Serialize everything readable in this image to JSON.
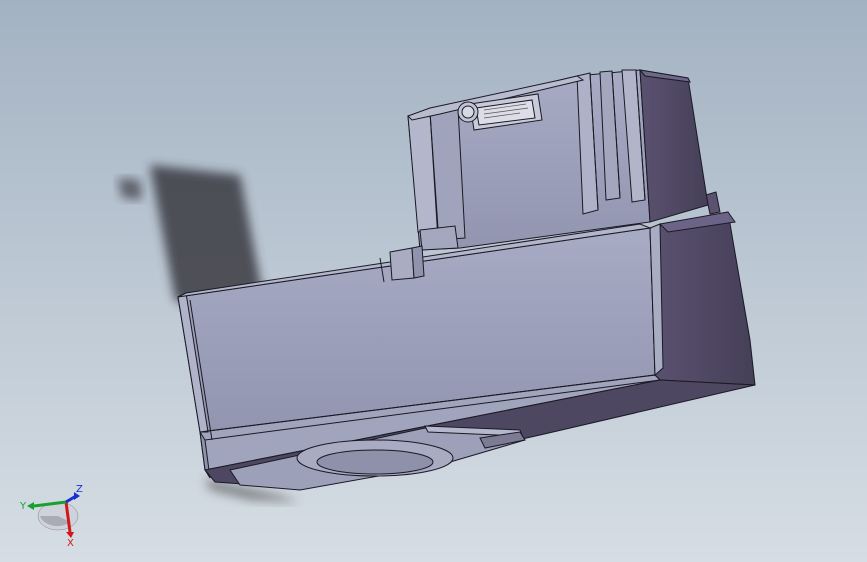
{
  "viewport": {
    "background_top": "#a3b2c2",
    "background_bottom": "#d6dde4"
  },
  "model": {
    "face_color": "#9ea3bc",
    "side_color": "#524a66",
    "shadow_color": "#3a3a40",
    "edge_color": "#1a1a24"
  },
  "triad": {
    "x_label": "X",
    "y_label": "Y",
    "z_label": "Z",
    "x_color": "#d01818",
    "y_color": "#18a030",
    "z_color": "#1830d0"
  }
}
